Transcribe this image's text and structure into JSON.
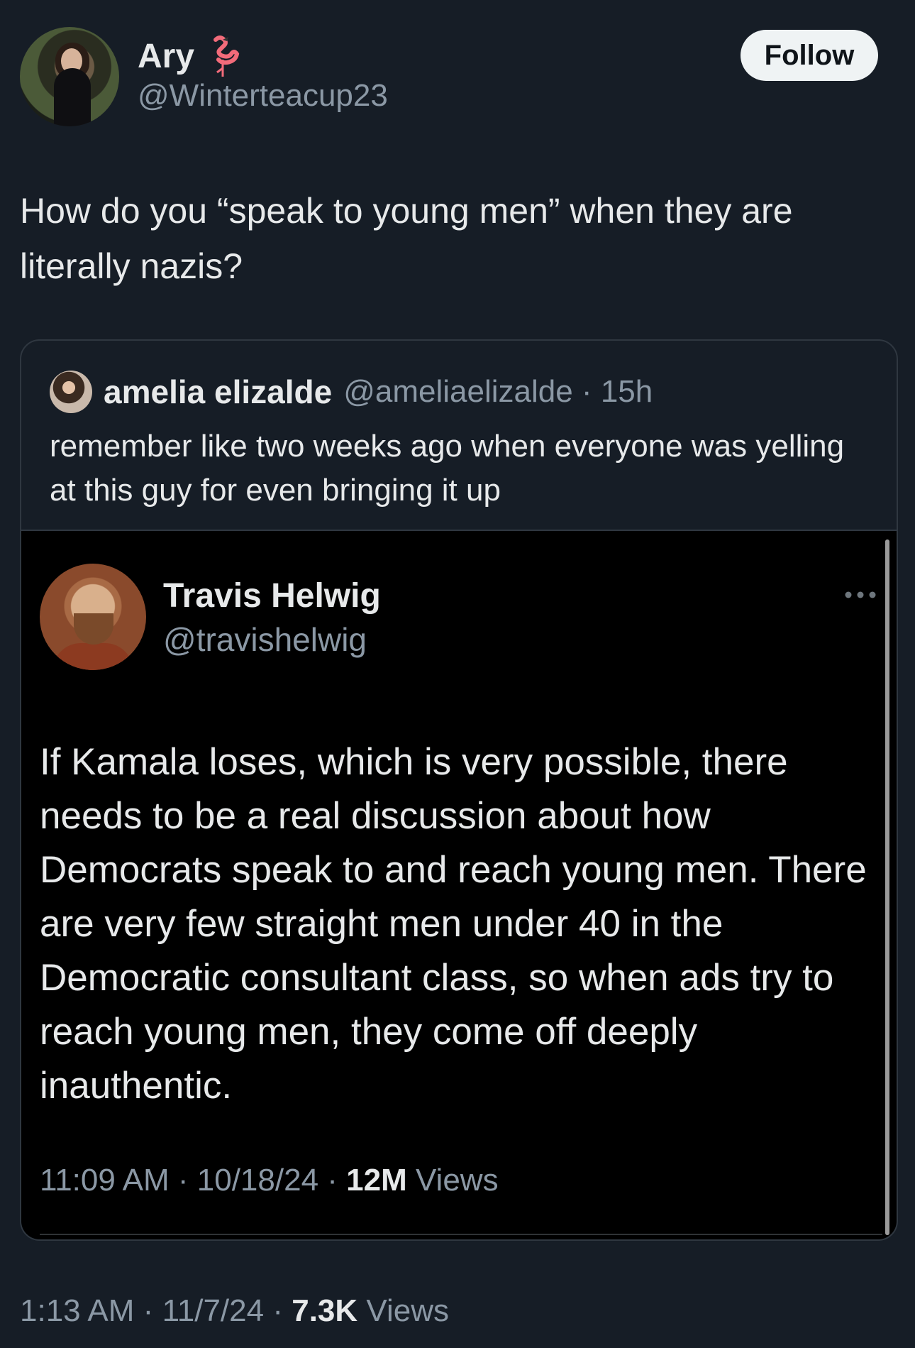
{
  "author": {
    "name": "Ary",
    "emoji_icon": "flamingo-icon",
    "handle": "@Winterteacup23"
  },
  "follow_label": "Follow",
  "tweet_text": "How do you “speak to young men” when they are literally nazis?",
  "quote": {
    "name": "amelia elizalde",
    "handle": "@ameliaelizalde",
    "separator": "·",
    "time": "15h",
    "text": "remember like two weeks ago when everyone was yelling at this guy for even bringing it up",
    "embedded": {
      "name": "Travis Helwig",
      "handle": "@travishelwig",
      "text": "If Kamala loses, which is very possible, there needs to be a real discussion about how Democrats speak to and reach young men. There are very few straight men under 40 in the Democratic consultant class, so when ads try to reach young men, they come off deeply inauthentic.",
      "time": "11:09 AM",
      "date": "10/18/24",
      "views_count": "12M",
      "views_label": "Views"
    }
  },
  "meta": {
    "time": "1:13 AM",
    "date": "11/7/24",
    "views_count": "7.3K",
    "views_label": "Views"
  },
  "colors": {
    "background": "#161d26",
    "text": "#e7e9ea",
    "secondary": "#8b98a5",
    "follow_bg": "#eff3f4"
  }
}
